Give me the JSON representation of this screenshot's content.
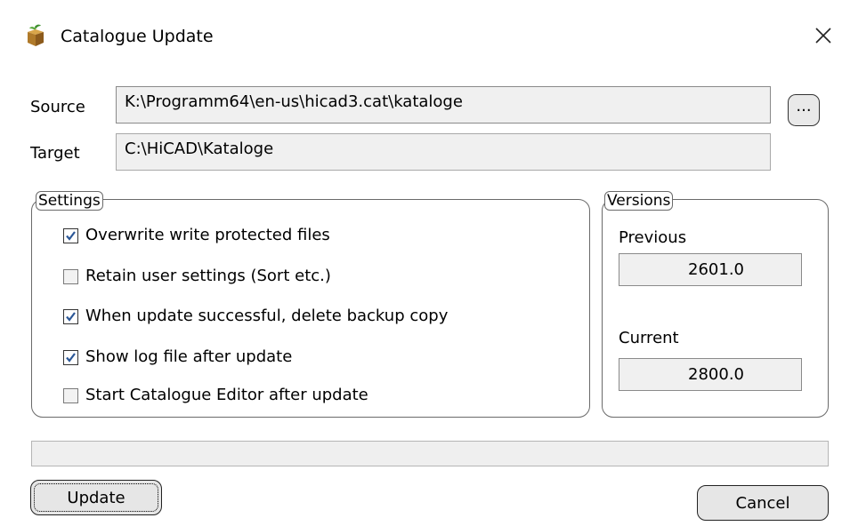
{
  "window": {
    "title": "Catalogue Update",
    "icon": "catalogue-box-icon",
    "close_icon": "close-icon"
  },
  "source": {
    "label": "Source",
    "value": "K:\\Programm64\\en-us\\hicad3.cat\\kataloge",
    "browse_label": "..."
  },
  "target": {
    "label": "Target",
    "value": "C:\\HiCAD\\Kataloge"
  },
  "settings": {
    "legend": "Settings",
    "options": [
      {
        "label": "Overwrite write protected files",
        "checked": true
      },
      {
        "label": "Retain user settings (Sort etc.)",
        "checked": false
      },
      {
        "label": "When update successful, delete backup copy",
        "checked": true
      },
      {
        "label": "Show log file after update",
        "checked": true
      },
      {
        "label": "Start Catalogue Editor after update",
        "checked": false
      }
    ]
  },
  "versions": {
    "legend": "Versions",
    "previous_label": "Previous",
    "previous_value": "2601.0",
    "current_label": "Current",
    "current_value": "2800.0"
  },
  "progress": {
    "value": 0
  },
  "buttons": {
    "update_label": "Update",
    "cancel_label": "Cancel"
  },
  "colors": {
    "checkmark": "#2b5797",
    "field_background": "#f0f0f0"
  }
}
